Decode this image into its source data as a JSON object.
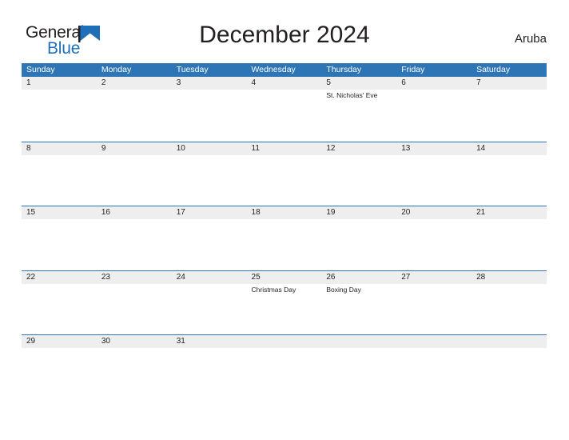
{
  "brand": {
    "name_part1": "General",
    "name_part2": "Blue",
    "triangle_color": "#1e6fb8",
    "logo_icon": "flag-triangle-icon"
  },
  "header": {
    "title": "December 2024",
    "country": "Aruba"
  },
  "colors": {
    "header_blue": "#2e75b6",
    "date_strip": "#eeeeee",
    "text": "#231f20",
    "brand_blue": "#1e6fb8"
  },
  "calendar": {
    "weekday_headers": [
      "Sunday",
      "Monday",
      "Tuesday",
      "Wednesday",
      "Thursday",
      "Friday",
      "Saturday"
    ],
    "weeks": [
      {
        "days": [
          {
            "date": "1",
            "events": []
          },
          {
            "date": "2",
            "events": []
          },
          {
            "date": "3",
            "events": []
          },
          {
            "date": "4",
            "events": []
          },
          {
            "date": "5",
            "events": [
              "St. Nicholas' Eve"
            ]
          },
          {
            "date": "6",
            "events": []
          },
          {
            "date": "7",
            "events": []
          }
        ]
      },
      {
        "days": [
          {
            "date": "8",
            "events": []
          },
          {
            "date": "9",
            "events": []
          },
          {
            "date": "10",
            "events": []
          },
          {
            "date": "11",
            "events": []
          },
          {
            "date": "12",
            "events": []
          },
          {
            "date": "13",
            "events": []
          },
          {
            "date": "14",
            "events": []
          }
        ]
      },
      {
        "days": [
          {
            "date": "15",
            "events": []
          },
          {
            "date": "16",
            "events": []
          },
          {
            "date": "17",
            "events": []
          },
          {
            "date": "18",
            "events": []
          },
          {
            "date": "19",
            "events": []
          },
          {
            "date": "20",
            "events": []
          },
          {
            "date": "21",
            "events": []
          }
        ]
      },
      {
        "days": [
          {
            "date": "22",
            "events": []
          },
          {
            "date": "23",
            "events": []
          },
          {
            "date": "24",
            "events": []
          },
          {
            "date": "25",
            "events": [
              "Christmas Day"
            ]
          },
          {
            "date": "26",
            "events": [
              "Boxing Day"
            ]
          },
          {
            "date": "27",
            "events": []
          },
          {
            "date": "28",
            "events": []
          }
        ]
      },
      {
        "days": [
          {
            "date": "29",
            "events": []
          },
          {
            "date": "30",
            "events": []
          },
          {
            "date": "31",
            "events": []
          },
          {
            "date": "",
            "events": []
          },
          {
            "date": "",
            "events": []
          },
          {
            "date": "",
            "events": []
          },
          {
            "date": "",
            "events": []
          }
        ]
      }
    ]
  }
}
